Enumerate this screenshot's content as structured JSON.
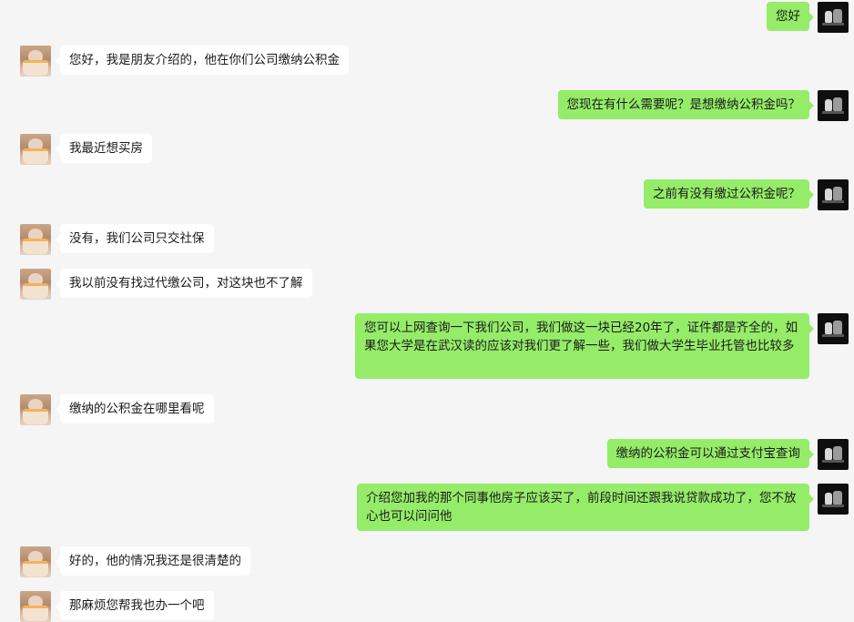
{
  "chat": {
    "messages": [
      {
        "side": "right",
        "avatar": "dark-avatar",
        "text": "您好"
      },
      {
        "side": "left",
        "avatar": "cat-avatar",
        "text": "您好，我是朋友介绍的，他在你们公司缴纳公积金"
      },
      {
        "side": "right",
        "avatar": "dark-avatar",
        "text": "您现在有什么需要呢？是想缴纳公积金吗？"
      },
      {
        "side": "left",
        "avatar": "cat-avatar",
        "text": "我最近想买房"
      },
      {
        "side": "right",
        "avatar": "dark-avatar",
        "text": "之前有没有缴过公积金呢？"
      },
      {
        "side": "left",
        "avatar": "cat-avatar",
        "text": "没有，我们公司只交社保"
      },
      {
        "side": "left",
        "avatar": "cat-avatar",
        "text": "我以前没有找过代缴公司，对这块也不了解"
      },
      {
        "side": "right",
        "avatar": "dark-avatar",
        "text": "您可以上网查询一下我们公司，我们做这一块已经20年了，证件都是齐全的，如果您大学是在武汉读的应该对我们更了解一些，我们做大学生毕业托管也比较多"
      },
      {
        "side": "left",
        "avatar": "cat-avatar",
        "text": "缴纳的公积金在哪里看呢"
      },
      {
        "side": "right",
        "avatar": "dark-avatar",
        "text": "缴纳的公积金可以通过支付宝查询"
      },
      {
        "side": "right",
        "avatar": "dark-avatar",
        "text": "介绍您加我的那个同事他房子应该买了，前段时间还跟我说贷款成功了，您不放心也可以问问他"
      },
      {
        "side": "left",
        "avatar": "cat-avatar",
        "text": "好的，他的情况我还是很清楚的"
      },
      {
        "side": "left",
        "avatar": "cat-avatar",
        "text": "那麻烦您帮我也办一个吧"
      }
    ]
  }
}
